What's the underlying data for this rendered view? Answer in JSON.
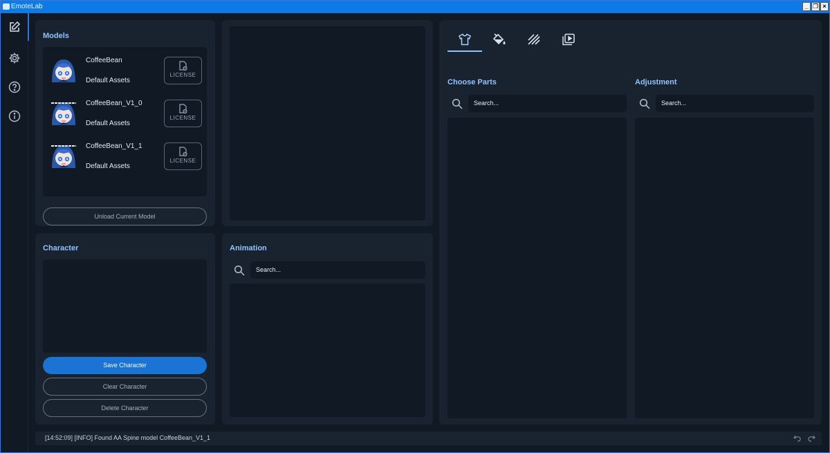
{
  "window": {
    "title": "EmoteLab"
  },
  "rail": {
    "items": [
      {
        "icon": "edit-icon",
        "active": true
      },
      {
        "icon": "gear-icon"
      },
      {
        "icon": "help-icon"
      },
      {
        "icon": "info-icon"
      }
    ]
  },
  "models": {
    "title": "Models",
    "license_label": "LICENSE",
    "items": [
      {
        "name": "CoffeeBean",
        "source": "Default Assets"
      },
      {
        "name": "CoffeeBean_V1_0",
        "source": "Default Assets"
      },
      {
        "name": "CoffeeBean_V1_1",
        "source": "Default Assets"
      }
    ],
    "unload_label": "Unload Current Model"
  },
  "character": {
    "title": "Character",
    "save_label": "Save Character",
    "clear_label": "Clear Character",
    "delete_label": "Delete Character"
  },
  "animation": {
    "title": "Animation",
    "search_placeholder": "Search..."
  },
  "customize": {
    "tabs": [
      {
        "icon": "shirt-icon",
        "active": true
      },
      {
        "icon": "paint-bucket-icon"
      },
      {
        "icon": "pattern-icon"
      },
      {
        "icon": "animation-clip-icon"
      }
    ],
    "choose_parts_title": "Choose Parts",
    "choose_parts_search": "Search...",
    "adjustment_title": "Adjustment",
    "adjustment_search": "Search..."
  },
  "status": {
    "log": "[14:52:09] [INFO] Found AA Spine model CoffeeBean_V1_1"
  },
  "colors": {
    "accent": "#1b74d4",
    "heading": "#8ec4ff",
    "panel": "#19222f",
    "inner": "#111924",
    "titlebar": "#0e7ae6"
  }
}
